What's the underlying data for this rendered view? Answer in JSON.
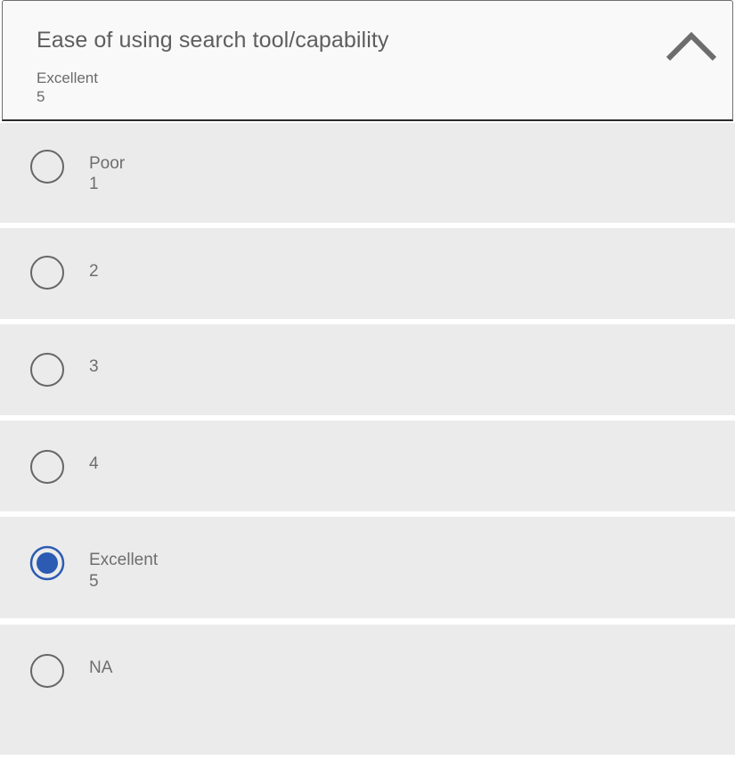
{
  "question": {
    "title": "Ease of using search tool/capability",
    "selected_label": "Excellent",
    "selected_value": "5",
    "expanded_icon": "chevron-up-icon"
  },
  "options": [
    {
      "label": "Poor",
      "value": "1",
      "selected": false
    },
    {
      "label": "",
      "value": "2",
      "selected": false
    },
    {
      "label": "",
      "value": "3",
      "selected": false
    },
    {
      "label": "",
      "value": "4",
      "selected": false
    },
    {
      "label": "Excellent",
      "value": "5",
      "selected": true
    },
    {
      "label": "",
      "value": "NA",
      "selected": false
    }
  ],
  "colors": {
    "accent": "#2b5bb3",
    "radio_border": "#666666",
    "option_bg": "#ebebeb",
    "header_bg": "#f9f9f9",
    "text": "#6e6e6e"
  }
}
